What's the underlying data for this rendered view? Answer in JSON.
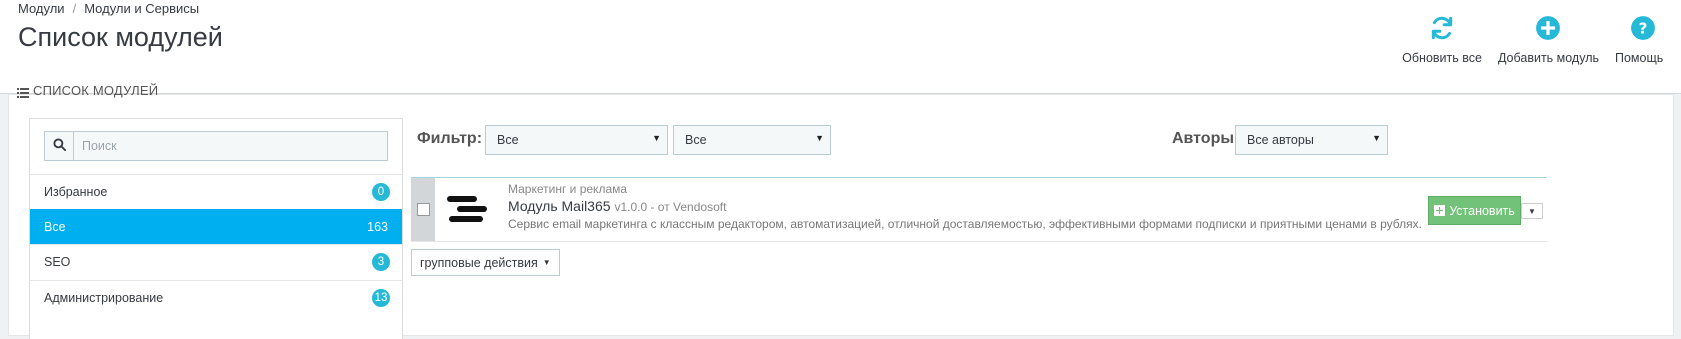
{
  "breadcrumb": {
    "parent": "Модули",
    "separator": "/",
    "current": "Модули и Сервисы"
  },
  "page": {
    "title": "Список модулей"
  },
  "toolbar": {
    "refresh_label": "Обновить все",
    "add_label": "Добавить модуль",
    "help_label": "Помощь"
  },
  "panel": {
    "heading": "СПИСОК МОДУЛЕЙ"
  },
  "search": {
    "placeholder": "Поиск",
    "value": ""
  },
  "categories": [
    {
      "label": "Избранное",
      "count": "0",
      "active": false
    },
    {
      "label": "Все",
      "count": "163",
      "active": true
    },
    {
      "label": "SEO",
      "count": "3",
      "active": false
    },
    {
      "label": "Администрирование",
      "count": "13",
      "active": false
    }
  ],
  "filters": {
    "filter_label": "Фильтр:",
    "select1": "Все",
    "select2": "Все",
    "authors_label": "Авторы",
    "authors_select": "Все авторы"
  },
  "module": {
    "category": "Маркетинг и реклама",
    "name": "Модуль Mail365",
    "version": "v1.0.0 - от Vendosoft",
    "description": "Сервис email маркетинга с классным редактором, автоматизацией, отличной доставляемостью, эффективными формами подписки и приятными ценами в рублях.",
    "install_label": "Установить"
  },
  "bulk": {
    "label": "групповые действия"
  },
  "colors": {
    "accent": "#25b9d7",
    "active": "#00aff0",
    "install": "#72c279"
  },
  "icons": [
    "refresh-icon",
    "add-circle-icon",
    "help-icon",
    "list-icon",
    "search-icon",
    "caret-down-icon"
  ]
}
